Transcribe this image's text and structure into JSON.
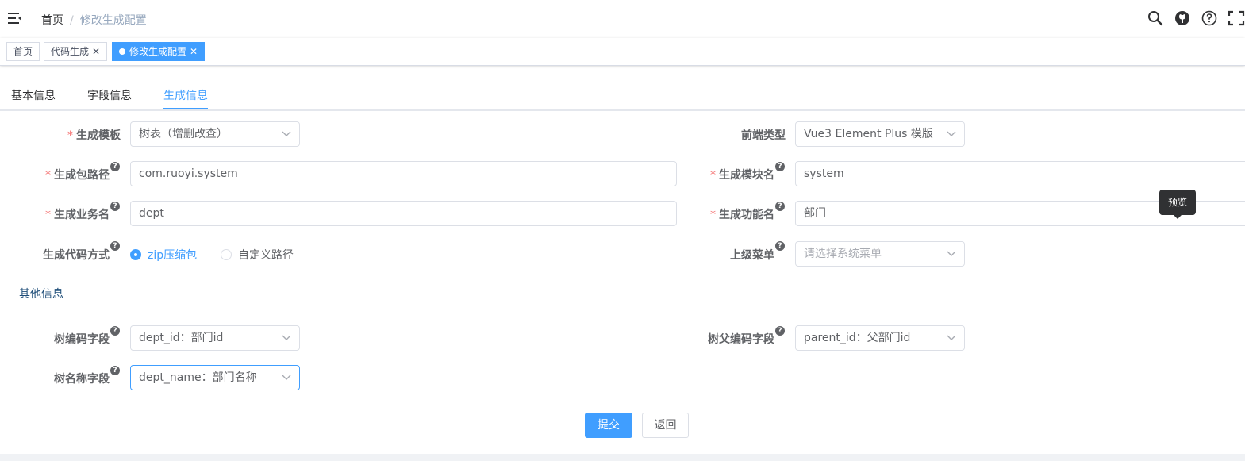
{
  "breadcrumb": {
    "home": "首页",
    "separator": "/",
    "current": "修改生成配置"
  },
  "header_icons": [
    "search-icon",
    "github-icon",
    "help-icon",
    "fullscreen-icon"
  ],
  "tags": [
    {
      "label": "首页"
    },
    {
      "label": "代码生成"
    },
    {
      "label": "修改生成配置"
    }
  ],
  "tabs": [
    {
      "label": "基本信息"
    },
    {
      "label": "字段信息"
    },
    {
      "label": "生成信息"
    }
  ],
  "form": {
    "tpl_category": {
      "label": "生成模板",
      "value": "树表（增删改查）"
    },
    "frontend_type": {
      "label": "前端类型",
      "value": "Vue3 Element Plus 模版"
    },
    "package_name": {
      "label": "生成包路径",
      "value": "com.ruoyi.system"
    },
    "module_name": {
      "label": "生成模块名",
      "value": "system"
    },
    "business_name": {
      "label": "生成业务名",
      "value": "dept"
    },
    "function_name": {
      "label": "生成功能名",
      "value": "部门"
    },
    "gen_type": {
      "label": "生成代码方式",
      "options": [
        "zip压缩包",
        "自定义路径"
      ]
    },
    "parent_menu": {
      "label": "上级菜单",
      "placeholder": "请选择系统菜单"
    }
  },
  "other_info": {
    "title": "其他信息",
    "tree_code": {
      "label": "树编码字段",
      "value": "dept_id：部门id"
    },
    "tree_parent_code": {
      "label": "树父编码字段",
      "value": "parent_id：父部门id"
    },
    "tree_name": {
      "label": "树名称字段",
      "value": "dept_name：部门名称"
    }
  },
  "tooltip": "预览",
  "buttons": {
    "submit": "提交",
    "back": "返回"
  },
  "colors": {
    "primary": "#409eff",
    "required": "#f56c6c",
    "section": "#1f4e79"
  }
}
